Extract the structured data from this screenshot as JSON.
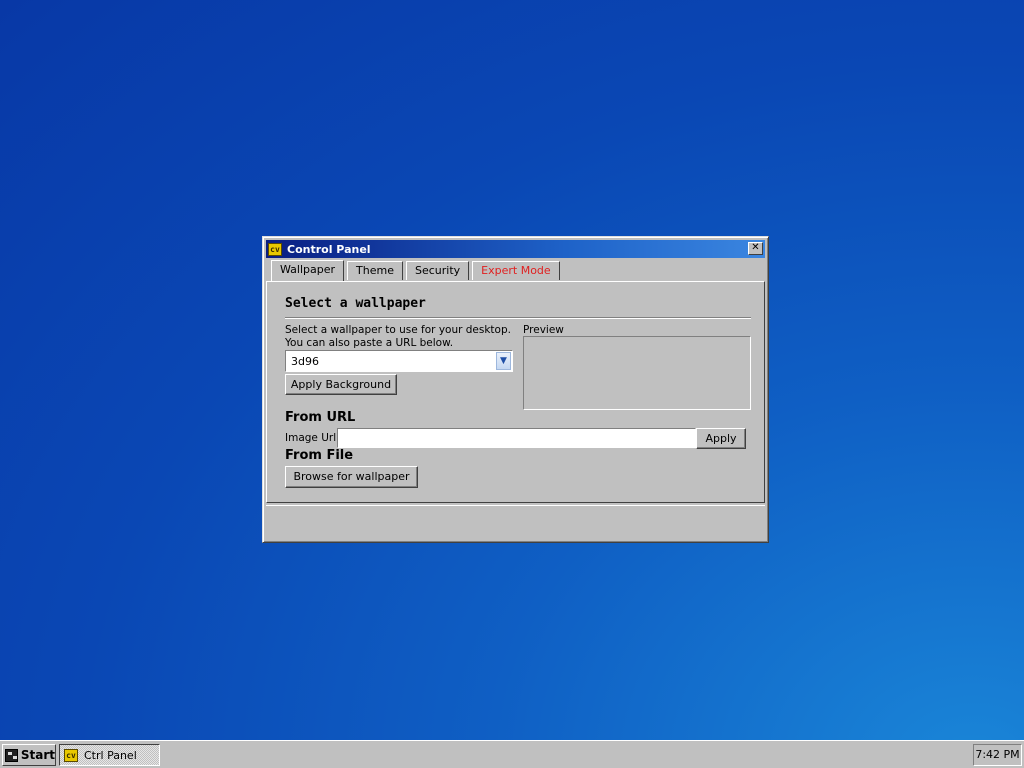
{
  "window": {
    "title": "Control Panel",
    "app_icon": "control-panel-icon",
    "close_glyph": "✕"
  },
  "tabs": [
    {
      "label": "Wallpaper",
      "active": true
    },
    {
      "label": "Theme",
      "active": false
    },
    {
      "label": "Security",
      "active": false
    },
    {
      "label": "Expert Mode",
      "active": false,
      "color": "#e02020"
    }
  ],
  "wallpaper": {
    "heading": "Select a wallpaper",
    "description_line1": "Select a wallpaper to use for your desktop.",
    "description_line2": "You can also paste a URL below.",
    "selected": "3d96",
    "apply_label": "Apply Background",
    "preview_label": "Preview"
  },
  "from_url": {
    "heading": "From URL",
    "field_label": "Image Url:",
    "value": "",
    "apply_label": "Apply"
  },
  "from_file": {
    "heading": "From File",
    "browse_label": "Browse for wallpaper"
  },
  "taskbar": {
    "start_label": "Start",
    "tasks": [
      {
        "label": "Ctrl Panel",
        "icon": "control-panel-icon"
      }
    ],
    "clock": "7:42 PM"
  }
}
